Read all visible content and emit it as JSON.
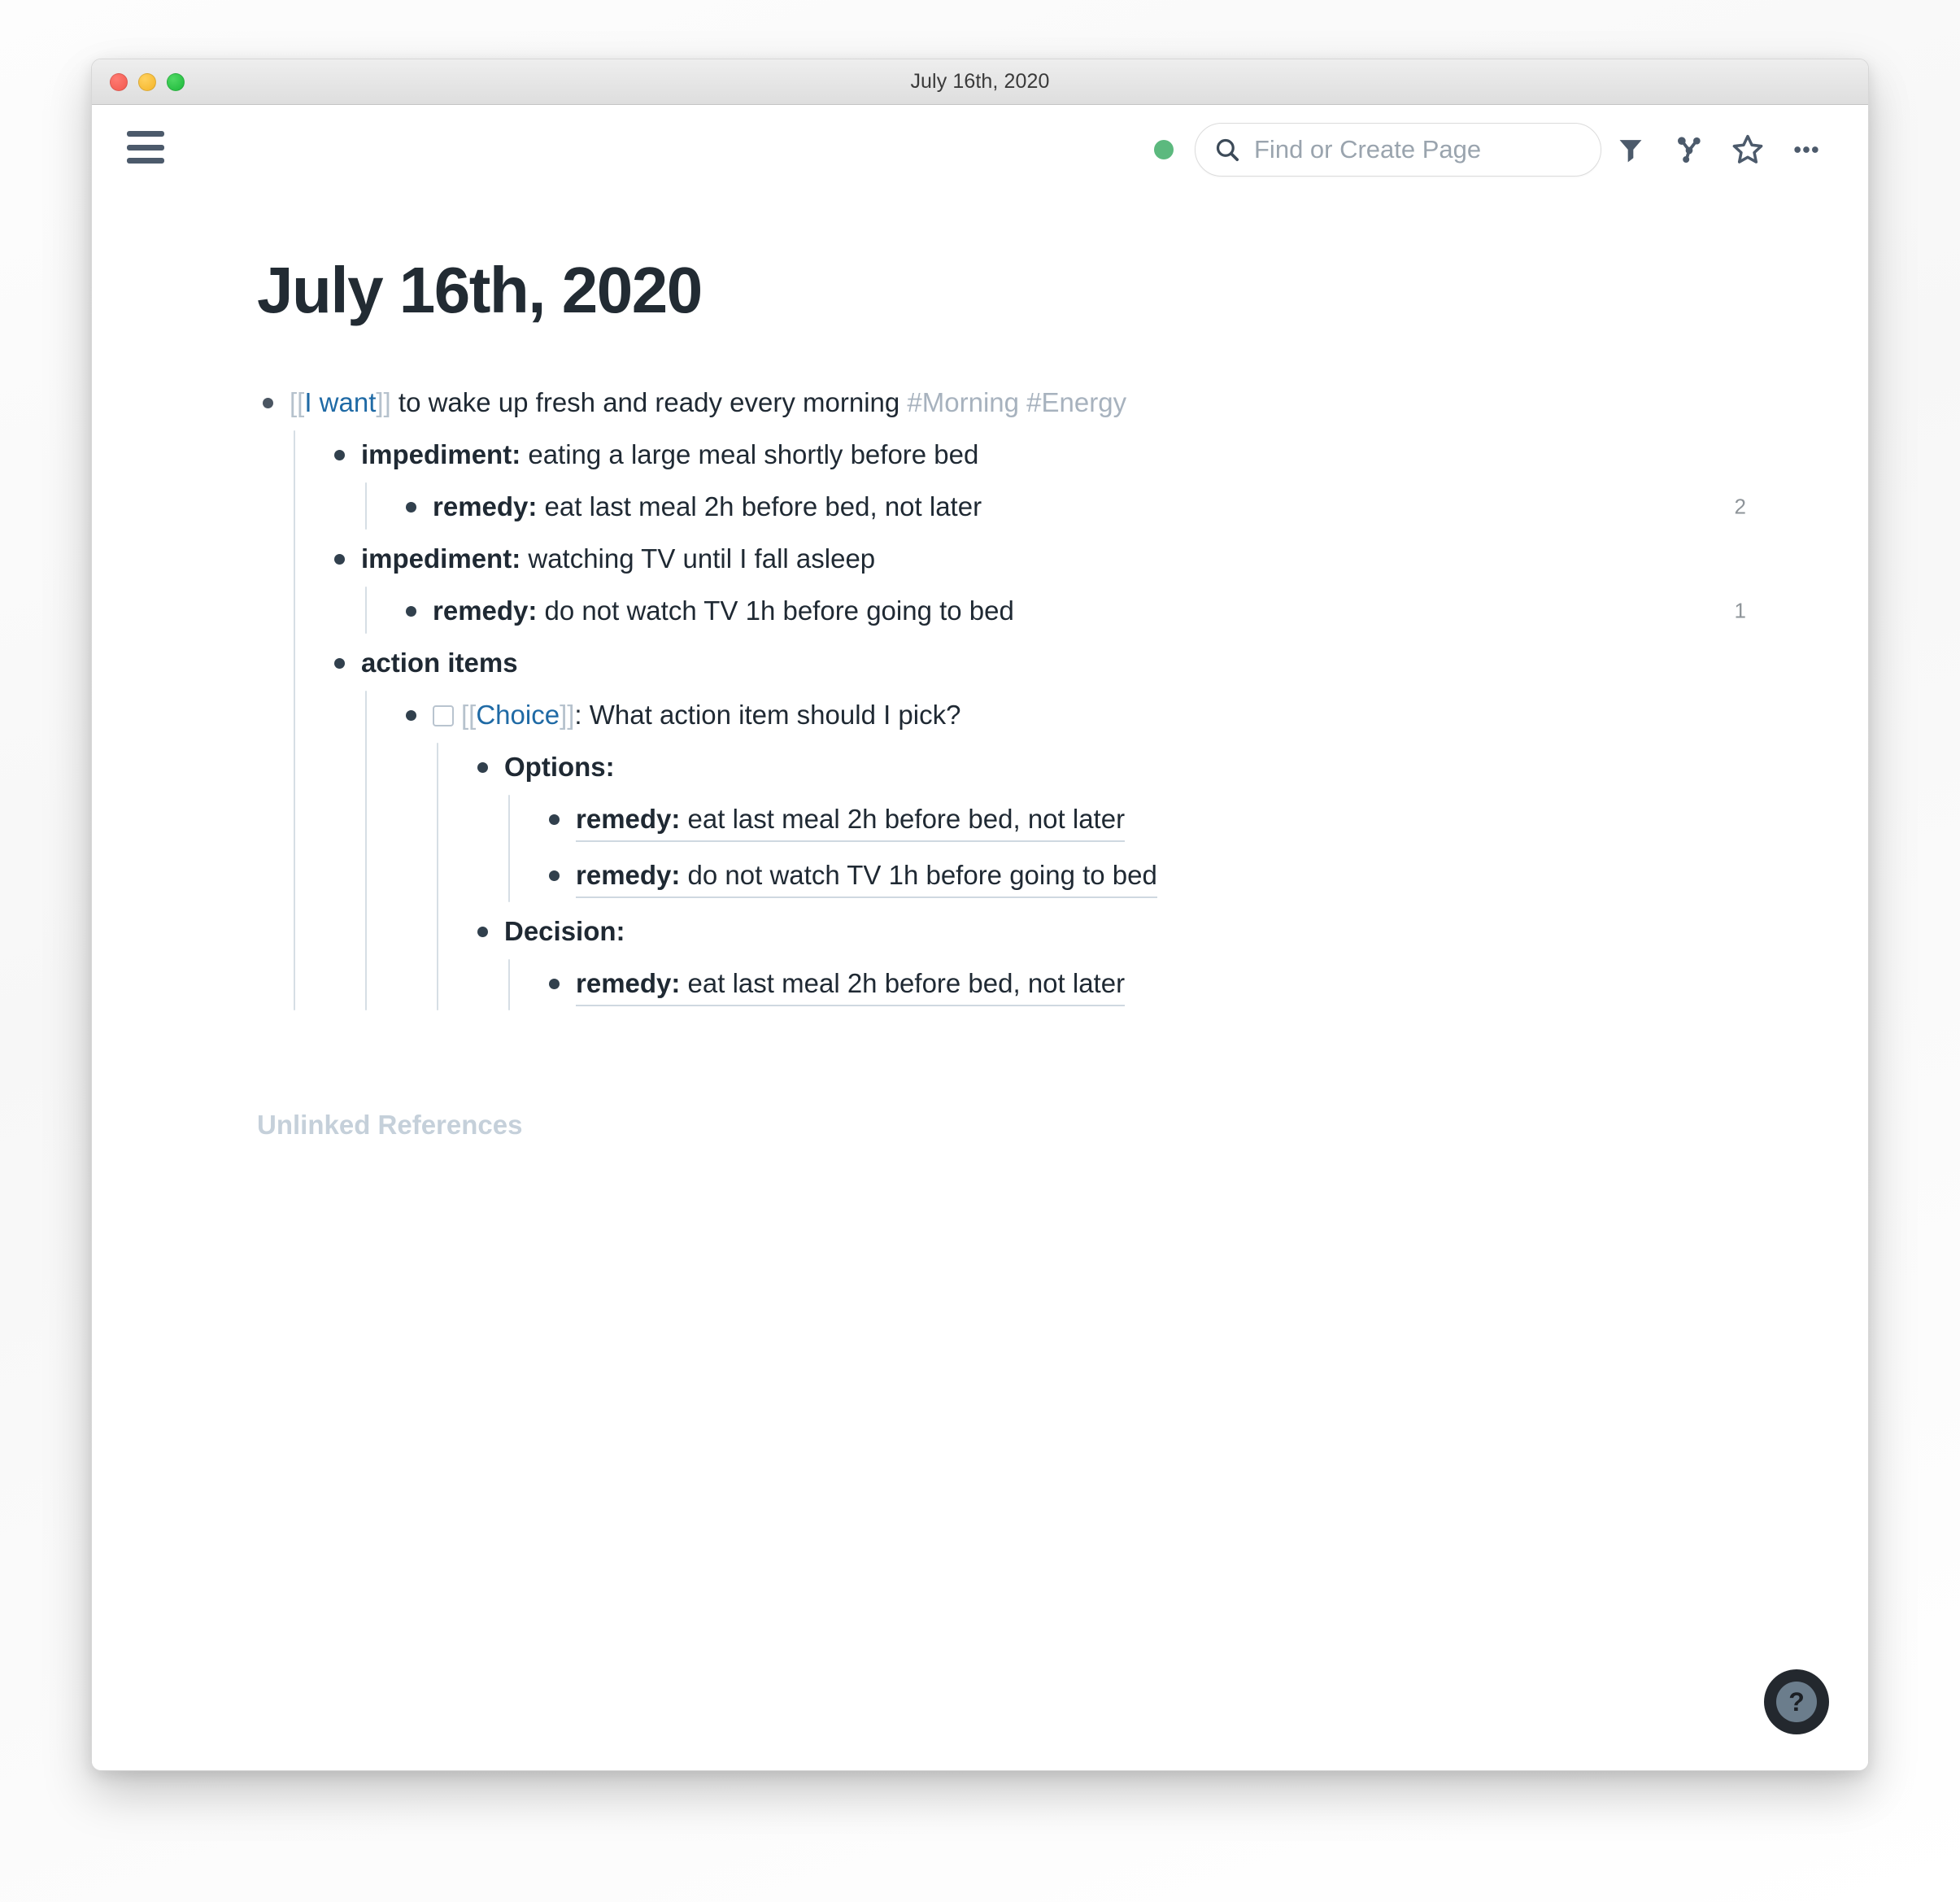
{
  "window": {
    "title": "July 16th, 2020",
    "traffic_lights": [
      "close-red",
      "minimize-yellow",
      "zoom-green"
    ]
  },
  "toolbar": {
    "menu_icon": "hamburger-icon",
    "status_dot": "online-status-dot",
    "status_color": "#5cb97e",
    "search": {
      "icon": "search-icon",
      "placeholder": "Find or Create Page",
      "value": ""
    },
    "icons": [
      {
        "name": "filter-icon",
        "label": "Filter"
      },
      {
        "name": "graph-icon",
        "label": "Graph Overview"
      },
      {
        "name": "star-icon",
        "label": "Favorite"
      },
      {
        "name": "more-icon",
        "label": "More Options"
      }
    ]
  },
  "page": {
    "title": "July 16th, 2020",
    "unlinked_references_label": "Unlinked References"
  },
  "blocks": {
    "root": {
      "link_open": "[[",
      "link_text": "I want",
      "link_close": "]]",
      "body": " to wake up fresh and ready every morning ",
      "tag1": "#Morning",
      "tag2": "#Energy"
    },
    "imp1": {
      "label": "impediment:",
      "text": " eating a large meal shortly before bed"
    },
    "imp1_remedy": {
      "label": "remedy:",
      "text": " eat last meal 2h before bed, not later",
      "refcount": "2"
    },
    "imp2": {
      "label": "impediment:",
      "text": " watching TV until I fall asleep"
    },
    "imp2_remedy": {
      "label": "remedy:",
      "text": " do not watch TV 1h before going to bed",
      "refcount": "1"
    },
    "action_items": {
      "label": "action items"
    },
    "choice": {
      "link_open": "[[",
      "link_text": "Choice",
      "link_close": "]]",
      "body": ": What action item should I pick?",
      "checked": false
    },
    "options": {
      "label": "Options:"
    },
    "option1": {
      "label": "remedy:",
      "text": " eat last meal 2h before bed, not later"
    },
    "option2": {
      "label": "remedy:",
      "text": " do not watch TV 1h before going to bed"
    },
    "decision": {
      "label": "Decision:"
    },
    "decision1": {
      "label": "remedy:",
      "text": " eat last meal 2h before bed, not later"
    }
  },
  "help": {
    "glyph": "?",
    "name": "help-button"
  },
  "colors": {
    "accent_link": "#1f6aa5",
    "tag": "#a7b2be",
    "bracket": "#b6c2cd",
    "text": "#1f2933",
    "guide_line": "#d6dee5",
    "status_green": "#5cb97e"
  }
}
